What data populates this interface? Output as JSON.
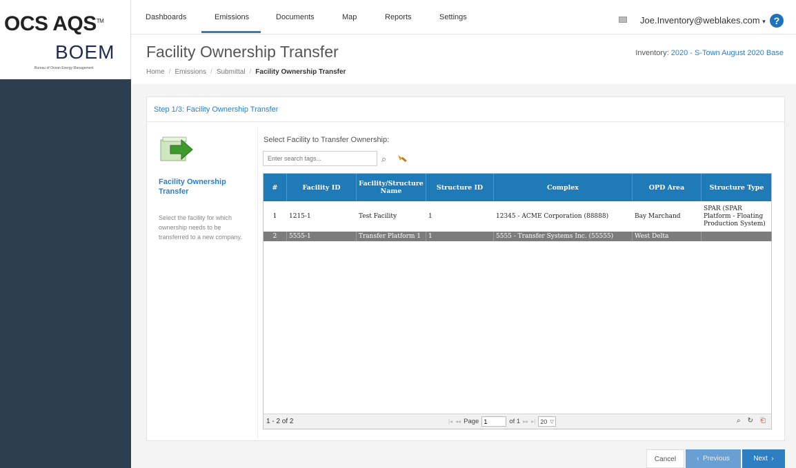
{
  "brand": {
    "title": "OCS AQS",
    "tm": "TM",
    "logo": "BOEM",
    "logo_sub": "Bureau of Ocean Energy Management"
  },
  "nav": {
    "items": [
      "Dashboards",
      "Emissions",
      "Documents",
      "Map",
      "Reports",
      "Settings"
    ],
    "active": "Emissions",
    "user": "Joe.Inventory@weblakes.com",
    "help": "?"
  },
  "header": {
    "title": "Facility Ownership Transfer",
    "inventory_label": "Inventory:",
    "inventory_value": "2020 - S-Town August 2020 Base",
    "breadcrumb": [
      "Home",
      "Emissions",
      "Submittal",
      "Facility Ownership Transfer"
    ]
  },
  "panel": {
    "step_title": "Step 1/3: Facility Ownership Transfer",
    "info_title": "Facility Ownership Transfer",
    "info_desc": "Select the facility for which ownership needs to be transferred to a new company.",
    "select_label": "Select Facility to Transfer Ownership:",
    "search_placeholder": "Enter search tags..."
  },
  "grid": {
    "columns": [
      "#",
      "Facility ID",
      "Facility/Structure Name",
      "Structure ID",
      "Complex",
      "OPD Area",
      "Structure Type"
    ],
    "rows": [
      [
        "1",
        "1215-1",
        "Test Facility",
        "1",
        "12345 - ACME Corporation (88888)",
        "Bay Marchand",
        "SPAR (SPAR Platform - Floating Production System)"
      ],
      [
        "2",
        "5555-1",
        "Transfer Platform 1",
        "1",
        "5555 - Transfer Systems Inc. (55555)",
        "West Delta",
        ""
      ]
    ],
    "selected_row": 2,
    "record_count": "1 - 2 of 2",
    "page_label": "Page",
    "page_value": "1",
    "of_label": "of 1",
    "page_size": "20"
  },
  "buttons": {
    "cancel": "Cancel",
    "previous": "Previous",
    "next": "Next"
  },
  "colors": {
    "primary": "#2d7fc1",
    "header_blue": "#1f7ab8",
    "sidebar": "#2c3e50",
    "selected_row": "#7c7c7c"
  }
}
